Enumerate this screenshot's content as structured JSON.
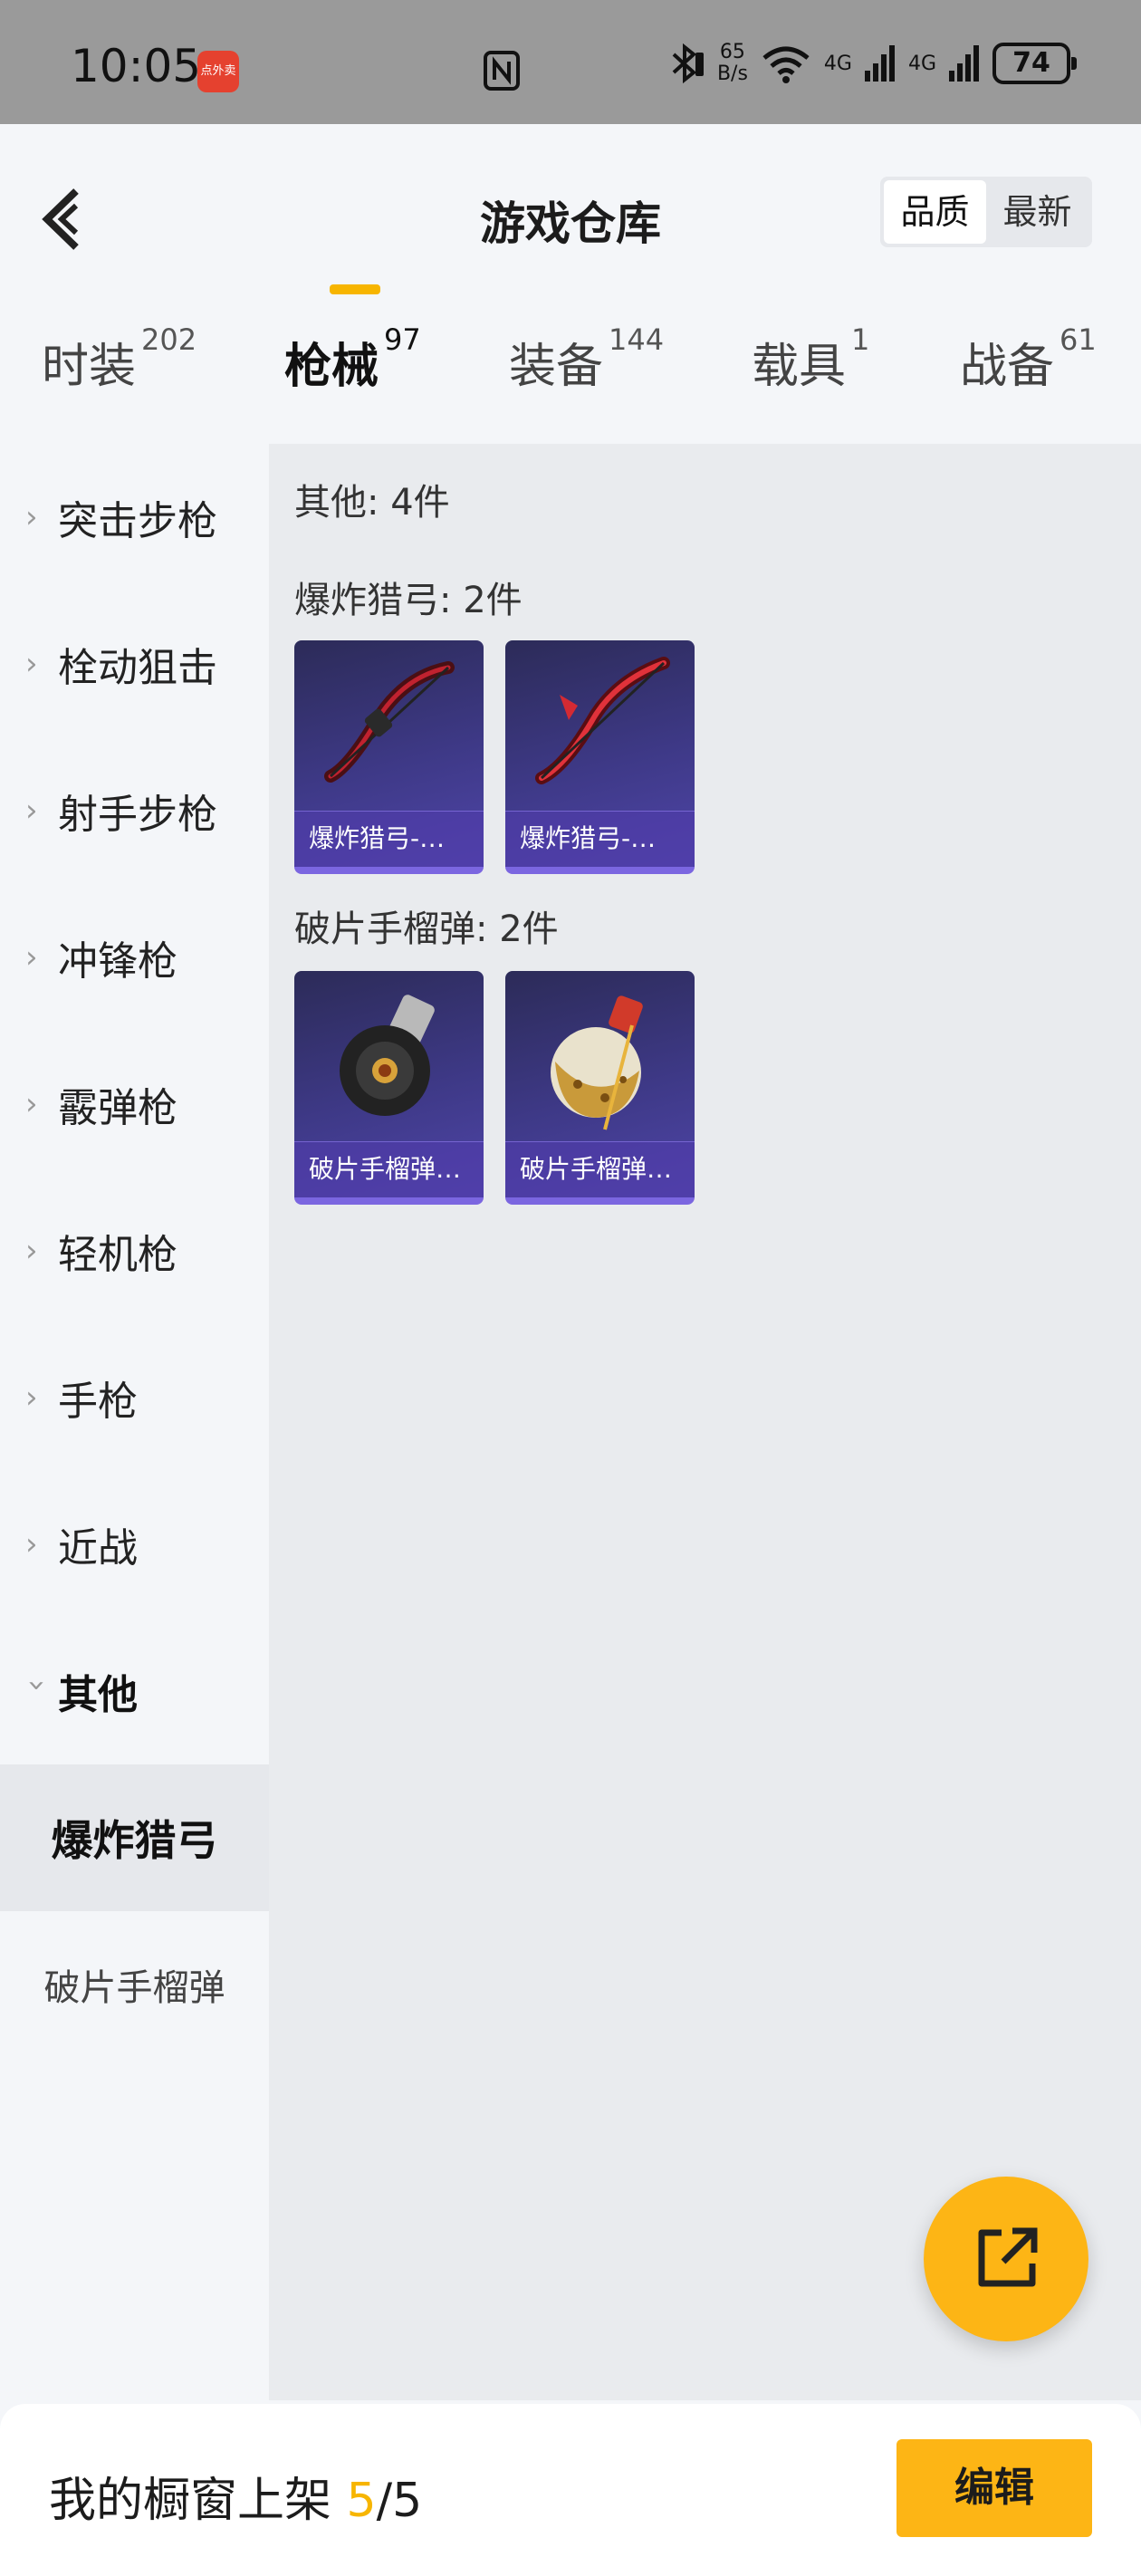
{
  "status_bar": {
    "time": "10:05",
    "app_badge": "点外卖",
    "net_speed_value": "65",
    "net_speed_unit": "B/s",
    "signal1": "4G",
    "signal2": "4G",
    "battery": "74"
  },
  "header": {
    "title": "游戏仓库",
    "sort_options": [
      "品质",
      "最新"
    ],
    "sort_selected": "品质"
  },
  "tabs": [
    {
      "label": "时装",
      "count": "202"
    },
    {
      "label": "枪械",
      "count": "97"
    },
    {
      "label": "装备",
      "count": "144"
    },
    {
      "label": "载具",
      "count": "1"
    },
    {
      "label": "战备",
      "count": "61"
    }
  ],
  "active_tab": "枪械",
  "sidebar": {
    "items": [
      {
        "label": "突击步枪"
      },
      {
        "label": "栓动狙击"
      },
      {
        "label": "射手步枪"
      },
      {
        "label": "冲锋枪"
      },
      {
        "label": "霰弹枪"
      },
      {
        "label": "轻机枪"
      },
      {
        "label": "手枪"
      },
      {
        "label": "近战"
      },
      {
        "label": "其他"
      }
    ],
    "subitems": [
      {
        "label": "爆炸猎弓"
      },
      {
        "label": "破片手榴弹"
      }
    ],
    "active_subitem": "爆炸猎弓"
  },
  "main": {
    "summary": "其他: 4件",
    "groups": [
      {
        "heading": "爆炸猎弓: 2件",
        "items": [
          {
            "name": "爆炸猎弓-惊…",
            "icon": "bow-icon"
          },
          {
            "name": "爆炸猎弓-炎…",
            "icon": "bow-icon"
          }
        ]
      },
      {
        "heading": "破片手榴弹: 2件",
        "items": [
          {
            "name": "破片手榴弹-…",
            "icon": "grenade-icon"
          },
          {
            "name": "破片手榴弹-…",
            "icon": "grenade-icon"
          }
        ]
      }
    ]
  },
  "fab": {
    "icon": "share-out-icon"
  },
  "bottom_bar": {
    "label": "我的橱窗上架",
    "count_current": "5",
    "count_sep": "/",
    "count_total": "5",
    "edit_label": "编辑"
  },
  "colors": {
    "accent": "#fdb515",
    "card_bg": "#3e3987",
    "card_border": "#7b66e0"
  }
}
